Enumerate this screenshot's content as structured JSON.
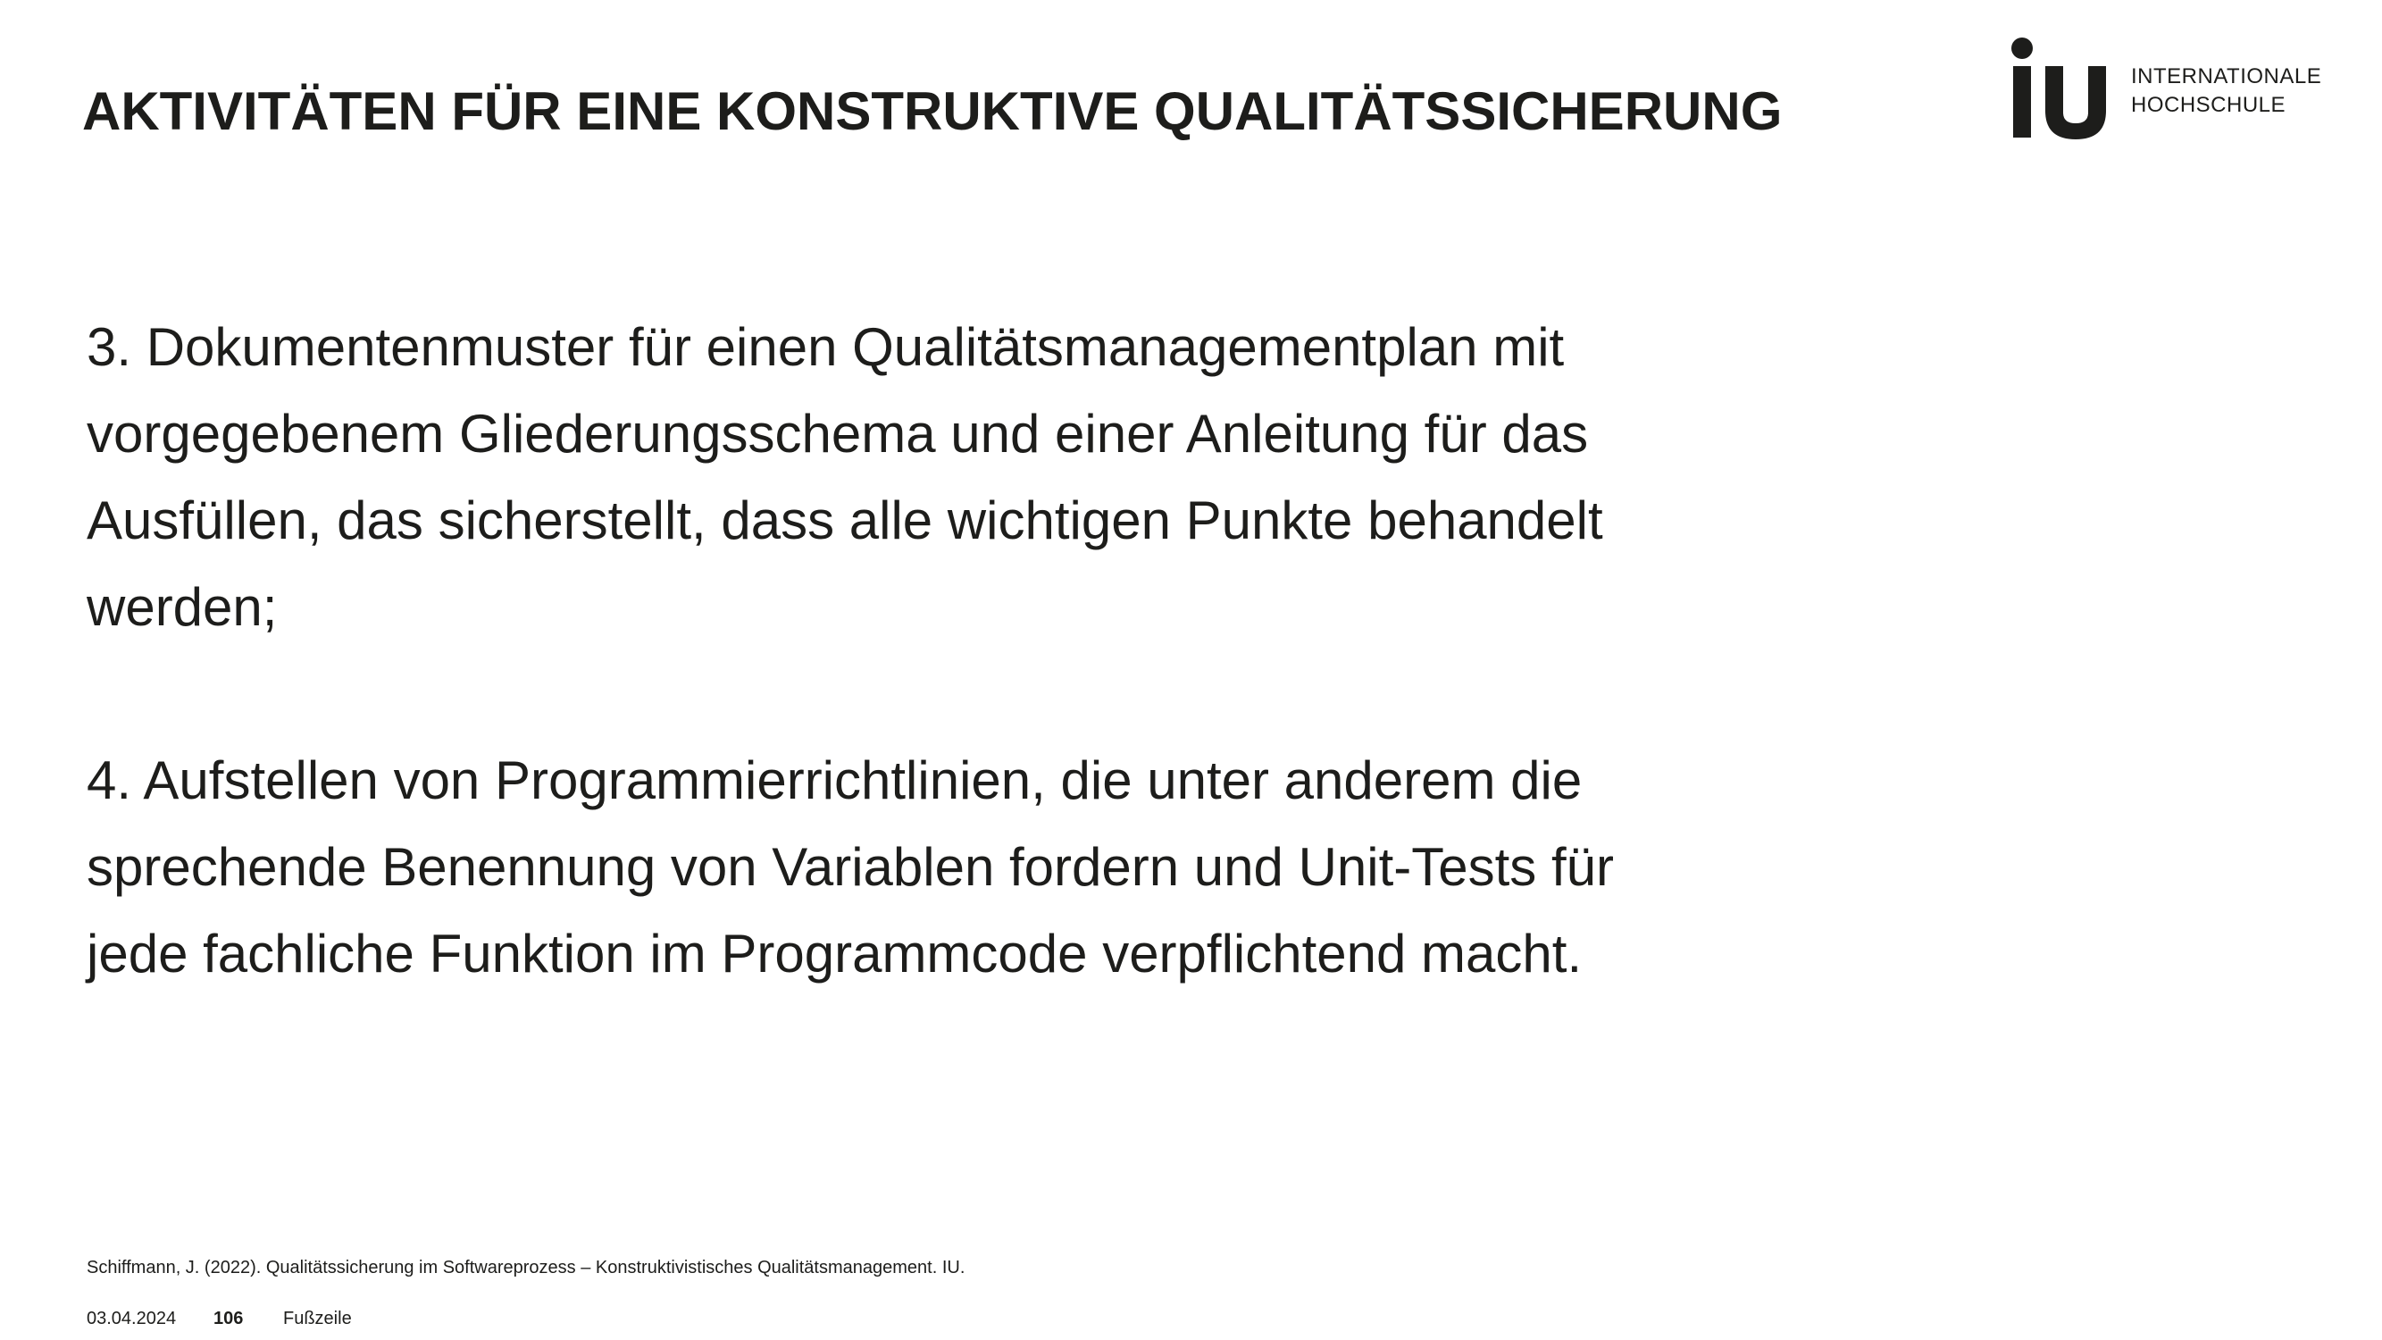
{
  "slide": {
    "title": "AKTIVITÄTEN FÜR EINE KONSTRUKTIVE QUALITÄTSSICHERUNG",
    "paragraphs": [
      "3. Dokumentenmuster für einen Qualitätsmanagementplan mit\nvorgegebenem Gliederungsschema und einer Anleitung für das\nAusfüllen, das sicherstellt, dass alle wichtigen Punkte behandelt\nwerden;",
      "4. Aufstellen von Programmierrichtlinien, die unter anderem die\nsprechende Benennung von Variablen fordern und Unit-Tests für\njede fachliche Funktion im Programmcode verpflichtend macht."
    ]
  },
  "logo": {
    "mark": "iu",
    "line1": "INTERNATIONALE",
    "line2": "HOCHSCHULE"
  },
  "citation": "Schiffmann, J. (2022). Qualitätssicherung im Softwareprozess – Konstruktivistisches Qualitätsmanagement. IU.",
  "footer": {
    "date": "03.04.2024",
    "page": "106",
    "label": "Fußzeile"
  }
}
